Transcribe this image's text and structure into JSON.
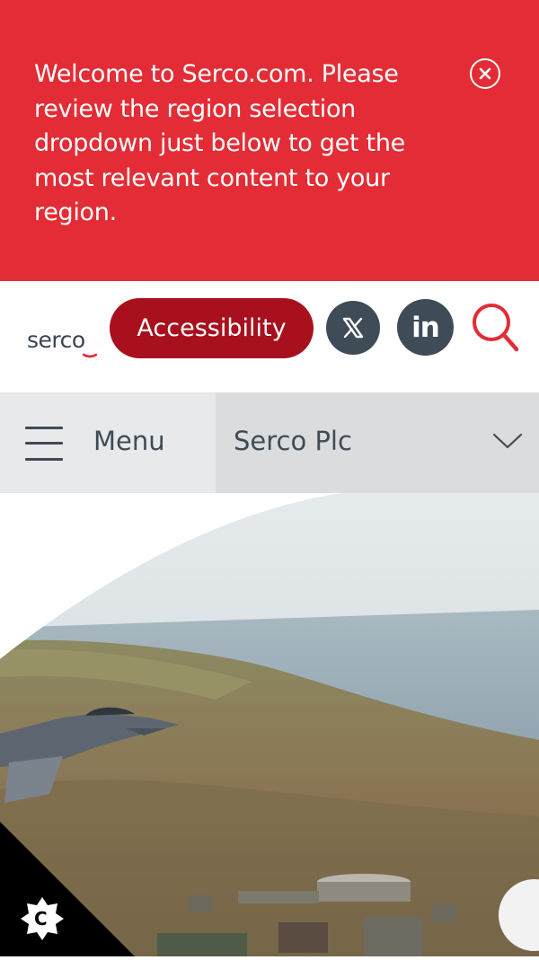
{
  "banner": {
    "message": "Welcome to Serco.com. Please review the region selection dropdown just below to get the most relevant content to your region.",
    "close_icon": "close-circle-icon"
  },
  "header": {
    "logo_text": "serco",
    "accessibility_label": "Accessibility",
    "social": {
      "x_icon": "x-twitter-icon",
      "linkedin_text": "in"
    },
    "search_icon": "search-icon"
  },
  "nav": {
    "menu_label": "Menu",
    "region_selected": "Serco Plc"
  },
  "hero": {
    "image": "hero-image-aircraft-over-hillside"
  },
  "cookie": {
    "icon": "cookie-settings-icon",
    "letter": "C"
  },
  "colors": {
    "banner_bg": "#e32c35",
    "accessibility_bg": "#a8101d",
    "social_bg": "#3f4b57",
    "search_icon": "#e32c35",
    "nav_bg": "#e9eaeb",
    "region_bg": "#dbdcdd"
  }
}
